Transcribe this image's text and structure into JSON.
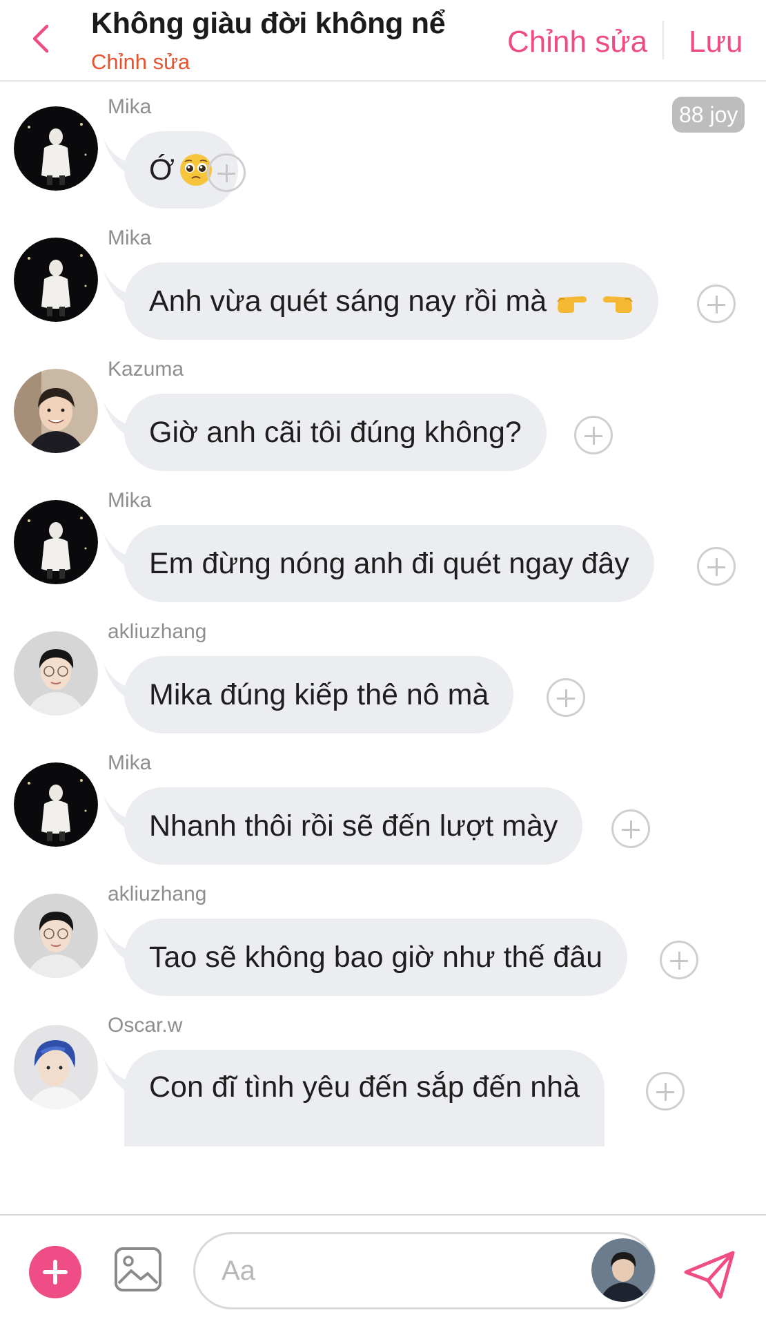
{
  "header": {
    "title": "Không giàu đời không nể",
    "subtitle": "Chỉnh sửa",
    "edit_label": "Chỉnh sửa",
    "save_label": "Lưu"
  },
  "chat": {
    "points_badge": "88 joy",
    "messages": [
      {
        "sender": "Mika",
        "text": "Ớ",
        "emoji": "pleading-face"
      },
      {
        "sender": "Mika",
        "text": "Anh vừa quét sáng nay rồi mà",
        "emoji": "pointing-fingers"
      },
      {
        "sender": "Kazuma",
        "text": "Giờ anh cãi tôi đúng không?"
      },
      {
        "sender": "Mika",
        "text": "Em đừng nóng anh đi quét ngay đây"
      },
      {
        "sender": "akliuzhang",
        "text": "Mika đúng kiếp thê nô mà"
      },
      {
        "sender": "Mika",
        "text": "Nhanh thôi rồi sẽ đến lượt mày"
      },
      {
        "sender": "akliuzhang",
        "text": "Tao sẽ không bao giờ như thế đâu"
      },
      {
        "sender": "Oscar.w",
        "text": "Con đĩ tình yêu đến sắp đến nhà"
      }
    ]
  },
  "composer": {
    "placeholder": "Aa",
    "value": ""
  },
  "colors": {
    "accent": "#ee4d86",
    "subtitle": "#e5532f",
    "bubble": "#ebedf0",
    "sender": "#8e8e8e"
  }
}
